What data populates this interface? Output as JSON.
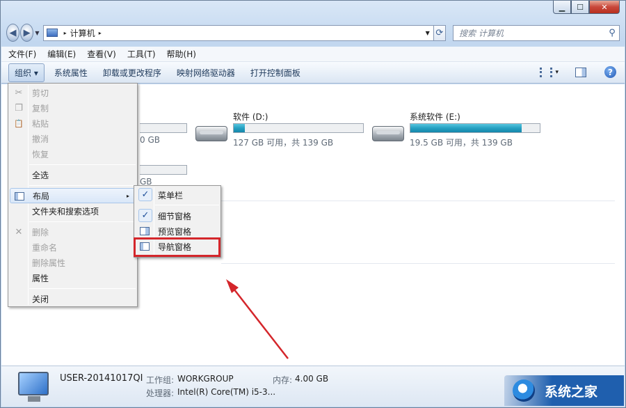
{
  "window": {
    "caption_buttons": {
      "minimize": "▁",
      "maximize": "☐",
      "close": "✕"
    }
  },
  "address": {
    "path_root_arrow": "▸",
    "path": "计算机",
    "path_arrow": "▸",
    "search_placeholder": "搜索 计算机"
  },
  "menubar": [
    "文件(F)",
    "编辑(E)",
    "查看(V)",
    "工具(T)",
    "帮助(H)"
  ],
  "cmdbar": {
    "organize": "组织 ▾",
    "items": [
      "系统属性",
      "卸载或更改程序",
      "映射网络驱动器",
      "打开控制面板"
    ],
    "view_dd": "▾",
    "help": "?"
  },
  "drives": [
    {
      "name": "软件 (D:)",
      "free": "127 GB 可用，共 139 GB",
      "used_fraction": 0.086
    },
    {
      "name": "系统软件 (E:)",
      "free": "19.5 GB 可用，共 139 GB",
      "used_fraction": 0.86
    }
  ],
  "partial_drive_texts": {
    "free1": "0 GB",
    "free2": "GB"
  },
  "organize_menu": {
    "items": [
      {
        "label": "剪切",
        "icon": "scissors-icon",
        "glyph": "✂",
        "disabled": true
      },
      {
        "label": "复制",
        "icon": "copy-icon",
        "glyph": "❐",
        "disabled": true
      },
      {
        "label": "粘贴",
        "icon": "paste-icon",
        "glyph": "📋",
        "disabled": true
      },
      {
        "label": "撤消",
        "disabled": true
      },
      {
        "label": "恢复",
        "disabled": true
      },
      {
        "label": "全选",
        "disabled": false
      },
      {
        "label": "布局",
        "disabled": false,
        "submenu_arrow": "▸"
      },
      {
        "label": "文件夹和搜索选项",
        "disabled": false
      },
      {
        "label": "删除",
        "icon": "delete-icon",
        "glyph": "✕",
        "disabled": true
      },
      {
        "label": "重命名",
        "disabled": true
      },
      {
        "label": "删除属性",
        "disabled": true
      },
      {
        "label": "属性",
        "disabled": false
      },
      {
        "label": "关闭",
        "disabled": false
      }
    ]
  },
  "layout_submenu": {
    "items": [
      {
        "label": "菜单栏",
        "checked": true,
        "check": "✓"
      },
      {
        "label": "细节窗格",
        "checked": true,
        "check": "✓"
      },
      {
        "label": "预览窗格",
        "checked": false
      },
      {
        "label": "导航窗格",
        "checked": false
      }
    ]
  },
  "status": {
    "computer_name": "USER-20141017QI",
    "workgroup_label": "工作组:",
    "workgroup": "WORKGROUP",
    "memory_label": "内存:",
    "memory": "4.00 GB",
    "processor_label": "处理器:",
    "processor": "Intel(R) Core(TM) i5-3..."
  },
  "watermark": {
    "text": "系统之家"
  }
}
